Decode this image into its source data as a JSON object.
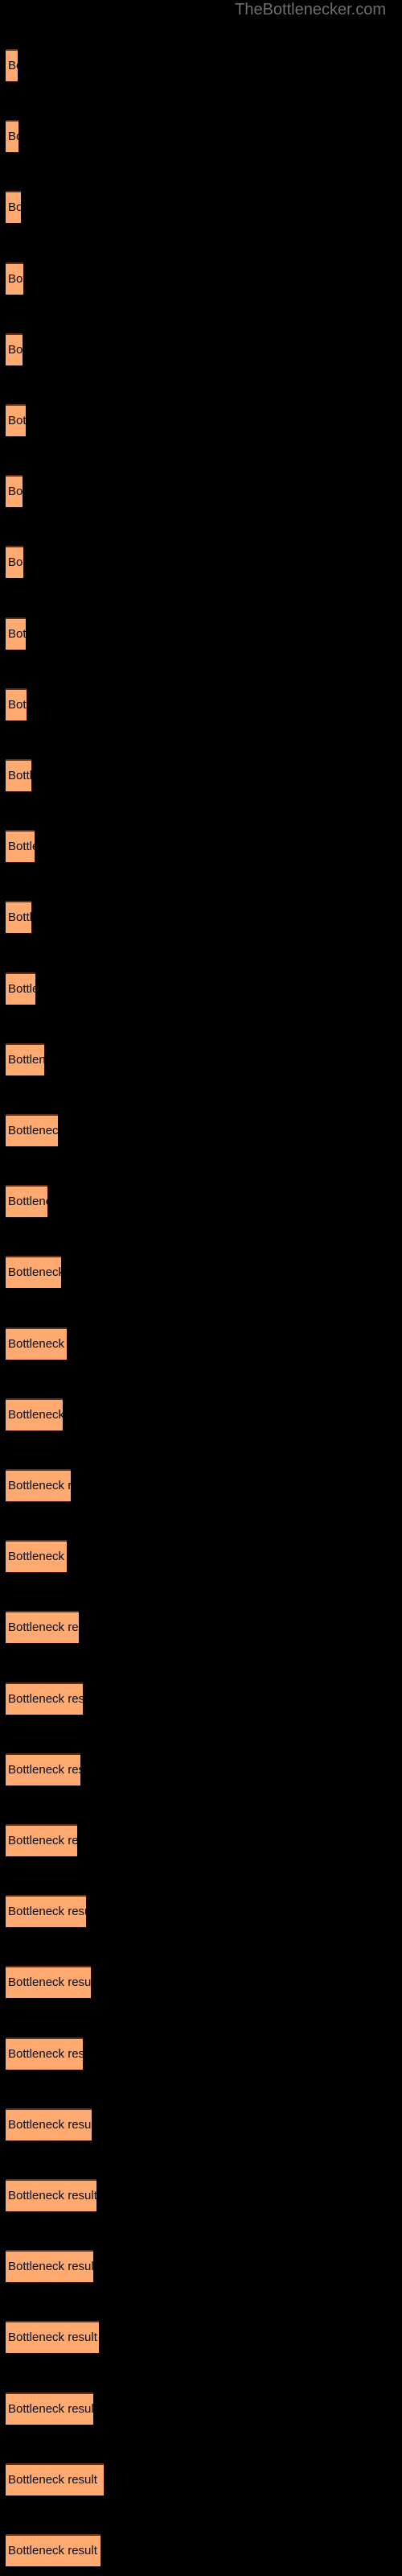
{
  "site": {
    "title": "TheBottlenecker.com",
    "title_color": "#6e6e6e"
  },
  "theme": {
    "background": "#000000",
    "bar_fill": "#ffaa70",
    "bar_top_edge": "#5e3018",
    "label_color": "#0a0a0a"
  },
  "chart_data": {
    "type": "bar",
    "orientation": "horizontal",
    "title": "TheBottlenecker.com",
    "xlabel": "",
    "ylabel": "",
    "grid": false,
    "legend": null,
    "axis_visible": false,
    "tick_labels": [],
    "bar_label_text": "Bottleneck result",
    "categories": [
      "Bottleneck result",
      "Bottleneck result",
      "Bottleneck result",
      "Bottleneck result",
      "Bottleneck result",
      "Bottleneck result",
      "Bottleneck result",
      "Bottleneck result",
      "Bottleneck result",
      "Bottleneck result",
      "Bottleneck result",
      "Bottleneck result",
      "Bottleneck result",
      "Bottleneck result",
      "Bottleneck result",
      "Bottleneck result",
      "Bottleneck result",
      "Bottleneck result",
      "Bottleneck result",
      "Bottleneck result",
      "Bottleneck result",
      "Bottleneck result",
      "Bottleneck result",
      "Bottleneck result",
      "Bottleneck result",
      "Bottleneck result",
      "Bottleneck result",
      "Bottleneck result",
      "Bottleneck result",
      "Bottleneck result",
      "Bottleneck result",
      "Bottleneck result",
      "Bottleneck result",
      "Bottleneck result",
      "Bottleneck result",
      "Bottleneck result"
    ],
    "values": [
      15,
      16,
      19,
      22,
      21,
      25,
      21,
      22,
      25,
      26,
      32,
      36,
      32,
      37,
      48,
      65,
      52,
      69,
      76,
      71,
      81,
      76,
      91,
      96,
      93,
      89,
      100,
      106,
      96,
      107,
      113,
      109,
      116,
      109,
      122,
      118
    ],
    "bar_pixel_widths": [
      15,
      16,
      19,
      22,
      21,
      25,
      21,
      22,
      25,
      26,
      32,
      36,
      32,
      37,
      48,
      65,
      52,
      69,
      76,
      71,
      81,
      76,
      91,
      96,
      93,
      89,
      100,
      106,
      96,
      107,
      113,
      109,
      116,
      109,
      122,
      118
    ],
    "xlim": [
      0,
      130
    ],
    "bar_count": 36
  }
}
